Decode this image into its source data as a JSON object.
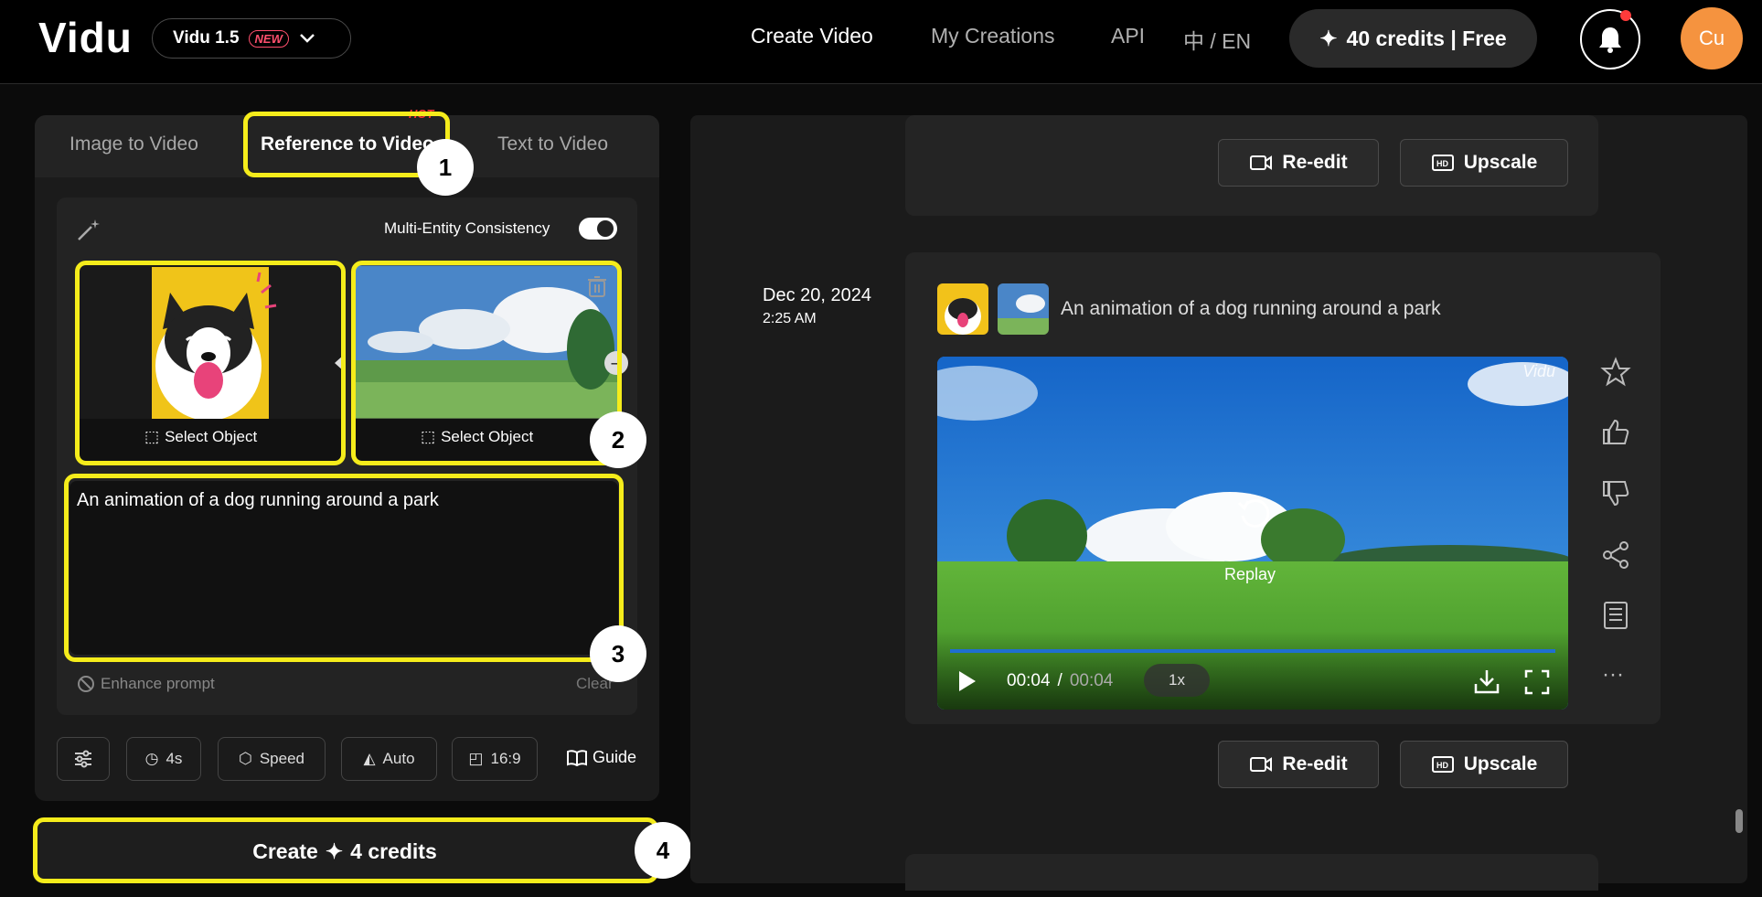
{
  "header": {
    "logo": "Vidu",
    "model": "Vidu 1.5",
    "model_badge": "NEW",
    "nav": [
      "Create Video",
      "My Creations",
      "API"
    ],
    "lang": "中 / EN",
    "credits": "40 credits | Free",
    "avatar": "Cu"
  },
  "left": {
    "tabs": [
      "Image to Video",
      "Reference to Video",
      "Text to Video"
    ],
    "hot_badge": "HOT",
    "multi_entity_label": "Multi-Entity Consistency",
    "multi_entity_on": true,
    "select_object": "Select Object",
    "prompt": "An animation of a dog running around a park",
    "enhance": "Enhance prompt",
    "clear": "Clear",
    "options": [
      "4s",
      "Speed",
      "Auto",
      "16:9"
    ],
    "guide": "Guide",
    "create_label": "Create",
    "create_credits": "4 credits"
  },
  "annotations": [
    "1",
    "2",
    "3",
    "4"
  ],
  "right": {
    "buttons": {
      "reedit": "Re-edit",
      "upscale": "Upscale"
    },
    "date": "Dec 20, 2024",
    "time": "2:25 AM",
    "title": "An animation of a dog running around a park",
    "video": {
      "watermark": "Vidu",
      "replay": "Replay",
      "current": "00:04",
      "sep": "/",
      "total": "00:04",
      "speed": "1x"
    }
  },
  "colors": {
    "accent_highlight": "#f5ec1b",
    "avatar": "#f5933f",
    "badge": "#ff4f6d"
  }
}
